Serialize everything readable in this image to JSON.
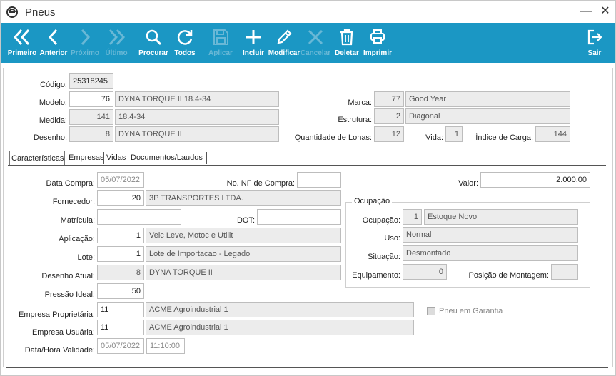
{
  "window": {
    "title": "Pneus",
    "minimize": "—",
    "close": "✕"
  },
  "toolbar": {
    "primeiro": "Primeiro",
    "anterior": "Anterior",
    "proximo": "Próximo",
    "ultimo": "Último",
    "procurar": "Procurar",
    "todos": "Todos",
    "aplicar": "Aplicar",
    "incluir": "Incluir",
    "modificar": "Modificar",
    "cancelar": "Cancelar",
    "deletar": "Deletar",
    "imprimir": "Imprimir",
    "sair": "Sair"
  },
  "header": {
    "codigo_label": "Código:",
    "codigo": "25318245",
    "modelo_label": "Modelo:",
    "modelo_id": "76",
    "modelo_nome": "DYNA TORQUE II 18.4-34",
    "medida_label": "Medida:",
    "medida_id": "141",
    "medida_nome": "18.4-34",
    "desenho_label": "Desenho:",
    "desenho_id": "8",
    "desenho_nome": "DYNA TORQUE II",
    "marca_label": "Marca:",
    "marca_id": "77",
    "marca_nome": "Good Year",
    "estrutura_label": "Estrutura:",
    "estrutura_id": "2",
    "estrutura_nome": "Diagonal",
    "lonas_label": "Quantidade de Lonas:",
    "lonas": "12",
    "vida_label": "Vida:",
    "vida": "1",
    "carga_label": "Índice de Carga:",
    "carga": "144"
  },
  "tabs": [
    "Características",
    "Empresas",
    "Vidas",
    "Documentos/Laudos"
  ],
  "caracteristicas": {
    "data_compra_label": "Data Compra:",
    "data_compra": "05/07/2022",
    "nf_label": "No. NF de Compra:",
    "nf": "",
    "valor_label": "Valor:",
    "valor": "2.000,00",
    "fornecedor_label": "Fornecedor:",
    "fornecedor_id": "20",
    "fornecedor_nome": "3P TRANSPORTES LTDA.",
    "matricula_label": "Matrícula:",
    "matricula": "",
    "dot_label": "DOT:",
    "dot": "",
    "aplicacao_label": "Aplicação:",
    "aplicacao_id": "1",
    "aplicacao_nome": "Veic Leve, Motoc e Utilit",
    "lote_label": "Lote:",
    "lote_id": "1",
    "lote_nome": "Lote de Importacao - Legado",
    "desenho_atual_label": "Desenho Atual:",
    "desenho_atual_id": "8",
    "desenho_atual_nome": "DYNA TORQUE II",
    "pressao_label": "Pressão Ideal:",
    "pressao": "50",
    "empresa_prop_label": "Empresa Proprietária:",
    "empresa_prop_id": "11",
    "empresa_prop_nome": "ACME Agroindustrial 1",
    "empresa_usu_label": "Empresa Usuária:",
    "empresa_usu_id": "11",
    "empresa_usu_nome": "ACME Agroindustrial 1",
    "validade_label": "Data/Hora Validade:",
    "validade_data": "05/07/2022",
    "validade_hora": "11:10:00",
    "garantia_label": "Pneu em Garantia"
  },
  "ocupacao": {
    "group_title": "Ocupação",
    "ocupacao_label": "Ocupação:",
    "ocupacao_id": "1",
    "ocupacao_nome": "Estoque Novo",
    "uso_label": "Uso:",
    "uso": "Normal",
    "situacao_label": "Situação:",
    "situacao": "Desmontado",
    "equipamento_label": "Equipamento:",
    "equipamento": "0",
    "posicao_label": "Posição de Montagem:",
    "posicao": ""
  }
}
